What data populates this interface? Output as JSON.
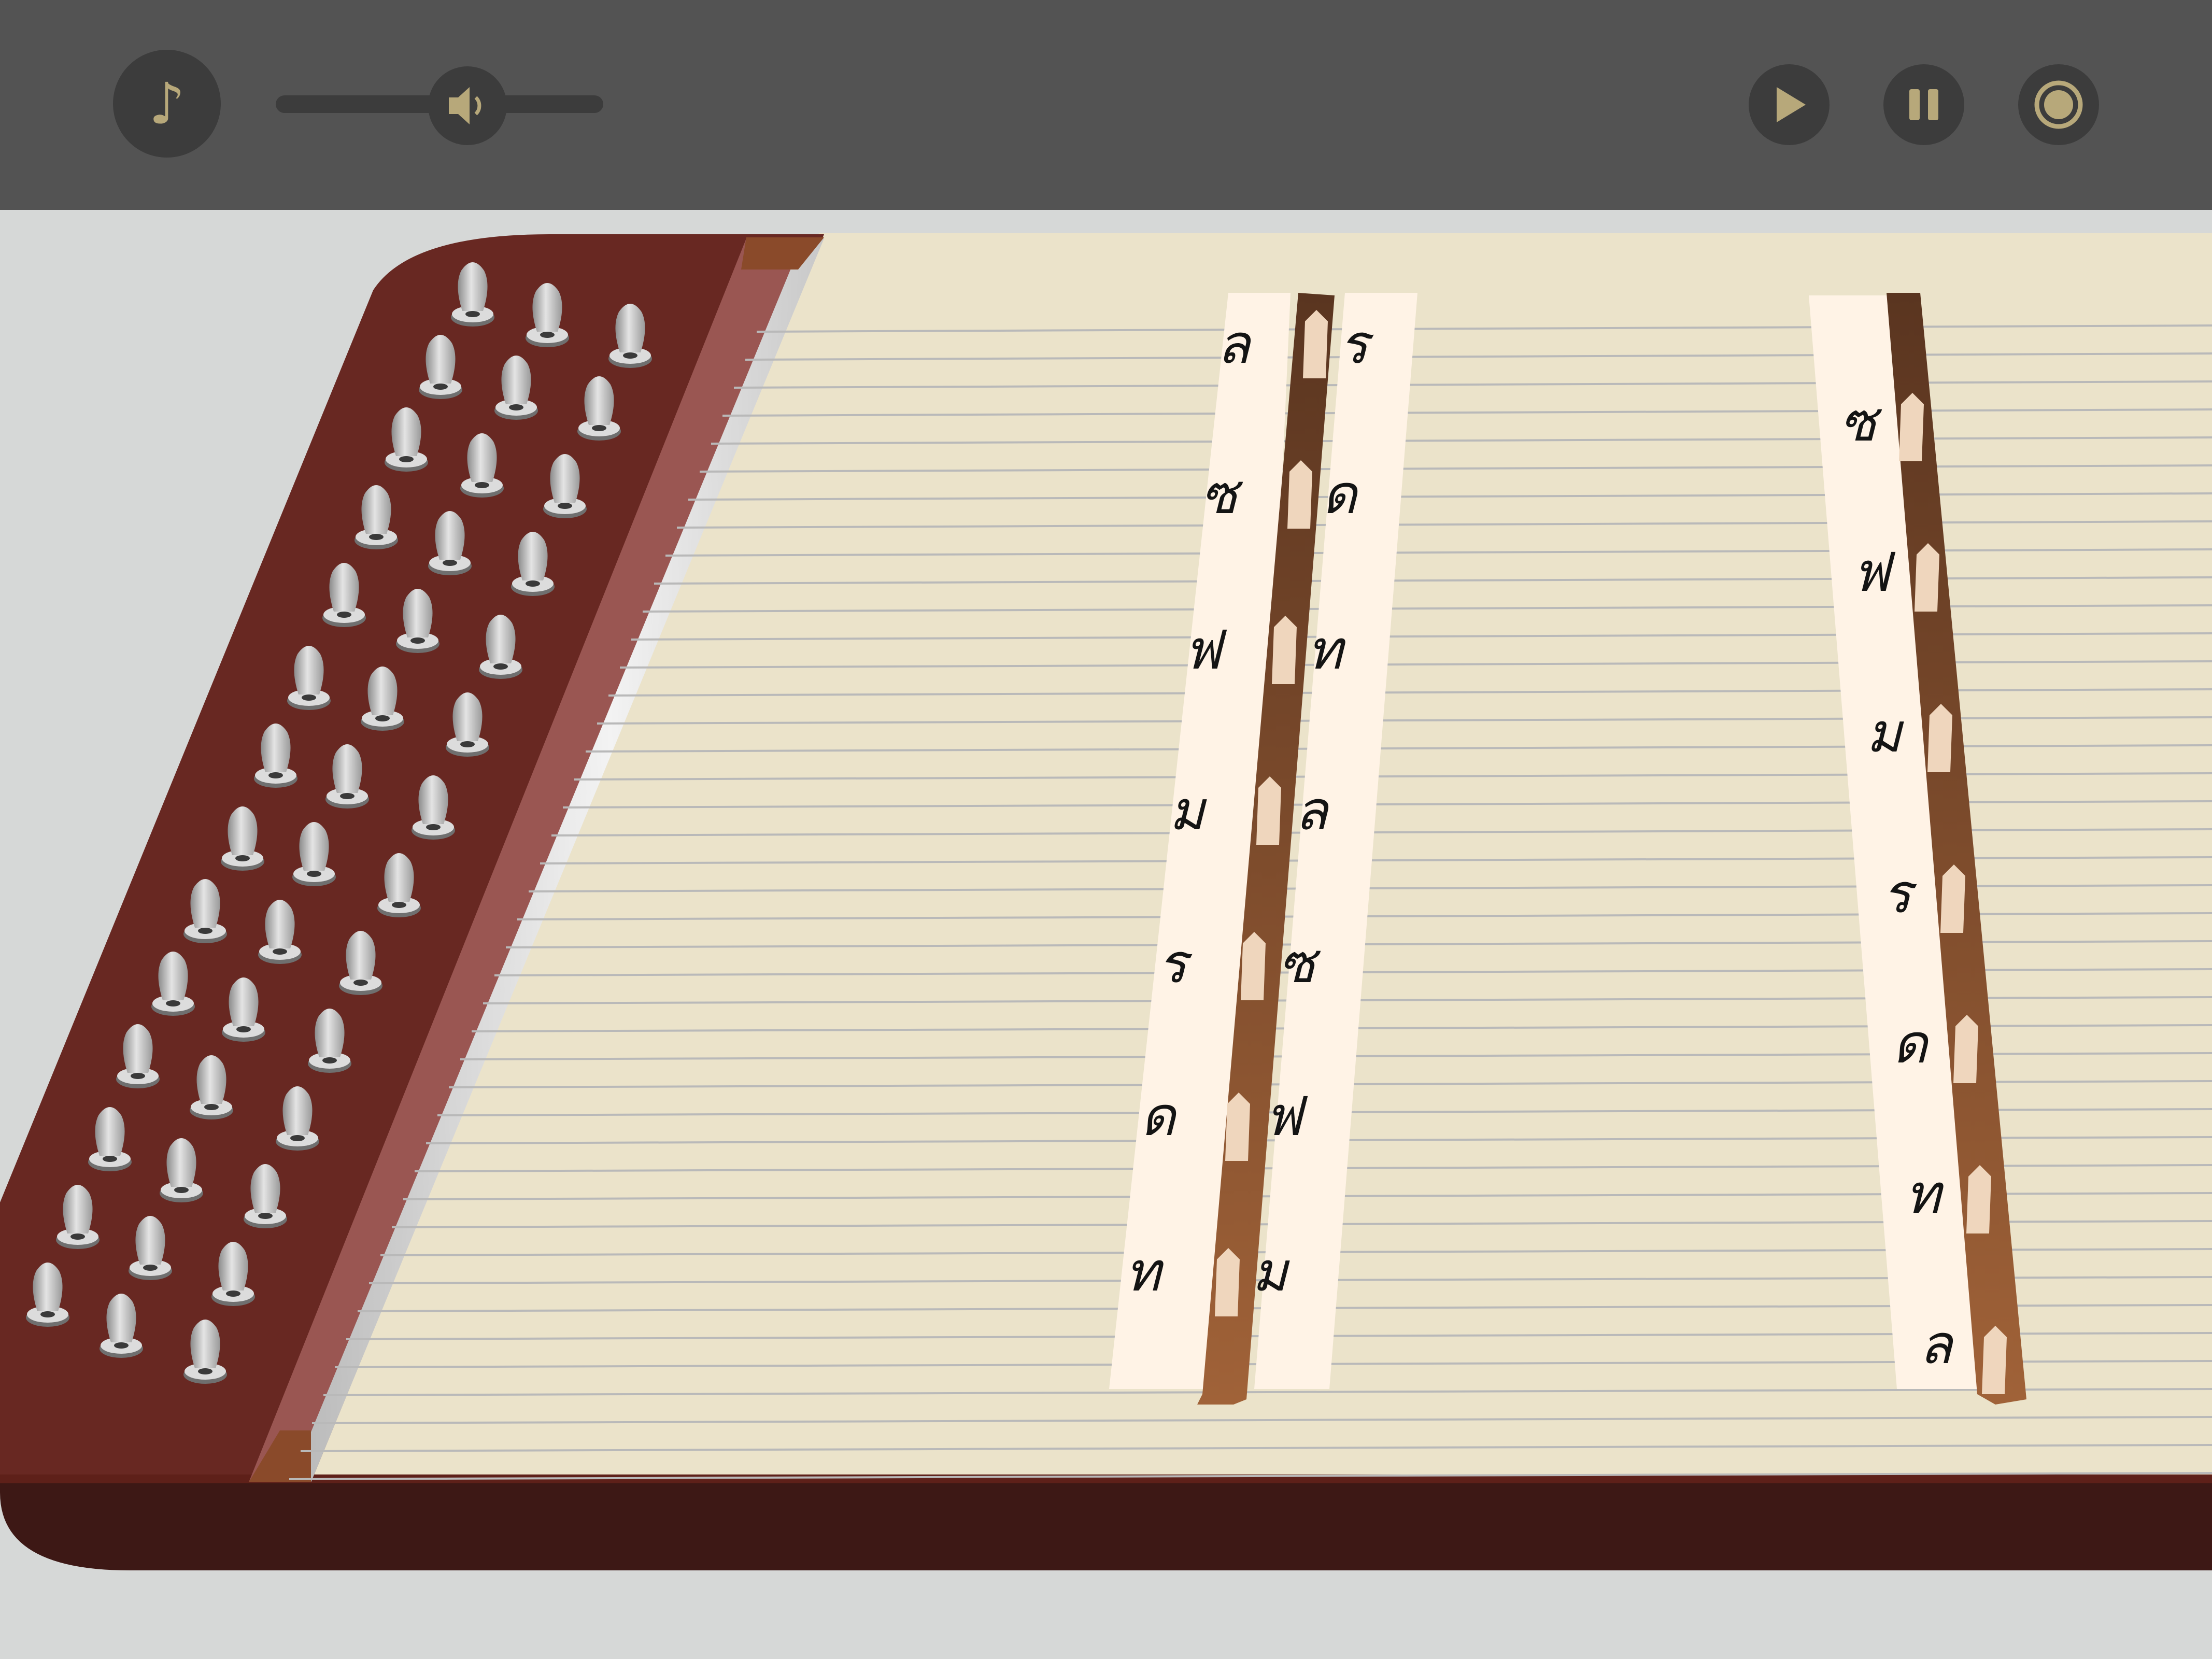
{
  "app": {
    "toolbar": {
      "buttons": [
        {
          "id": "instrument-select",
          "icon": "music-note-icon"
        },
        {
          "id": "play",
          "icon": "play-icon"
        },
        {
          "id": "pause",
          "icon": "pause-icon"
        },
        {
          "id": "record",
          "icon": "record-icon"
        }
      ],
      "volume": {
        "icon": "speaker-icon",
        "level": 0.5
      },
      "music_glyph": "♪"
    },
    "colors": {
      "toolbar_bg": "#535353",
      "button_bg": "#3c3c3c",
      "accent_gold": "#b7a87a",
      "page_bg": "#d6d8d7",
      "wood_top": "#682822",
      "wood_side": "#3d1815",
      "soundboard": "#ebe3ca",
      "note_strip": "#fff3e6",
      "bridge_dark": "#5a3520",
      "bridge_light": "#a06238"
    },
    "instrument": {
      "name_icon": "khim-icon",
      "bridge_left": {
        "left_labels": [
          "ล",
          "ซ",
          "ฟ",
          "ม",
          "ร",
          "ด",
          "ท"
        ],
        "right_labels": [
          "ร",
          "ด",
          "ท",
          "ล",
          "ซ",
          "ฟ",
          "ม"
        ]
      },
      "bridge_right": {
        "labels": [
          "ซ",
          "ฟ",
          "ม",
          "ร",
          "ด",
          "ท",
          "ล"
        ]
      }
    }
  }
}
